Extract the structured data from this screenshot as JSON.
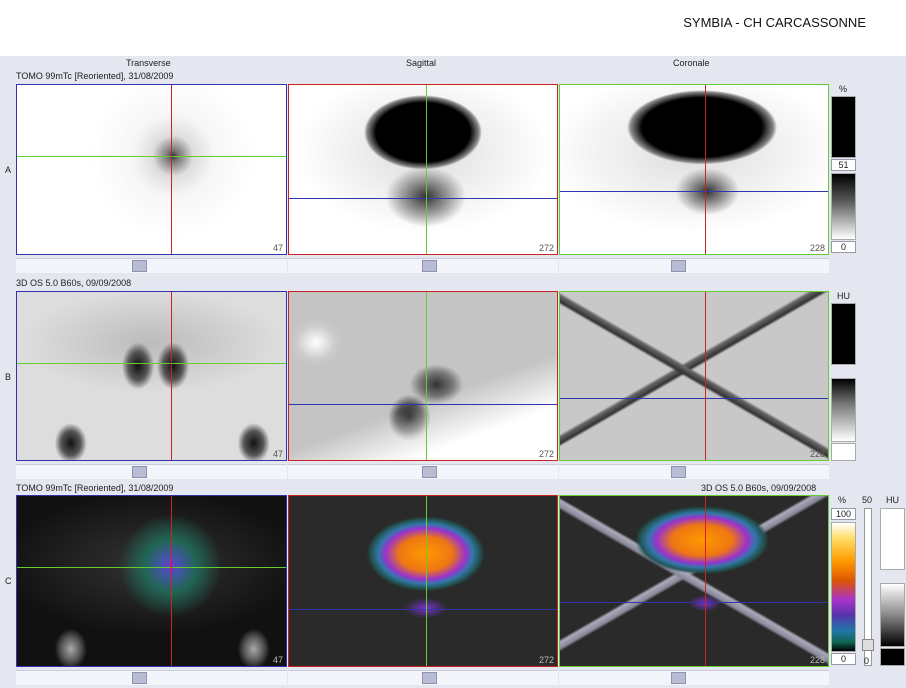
{
  "header": {
    "site_title": "SYMBIA - CH CARCASSONNE"
  },
  "columns": {
    "transverse": "Transverse",
    "sagittal": "Sagittal",
    "coronal": "Coronale"
  },
  "rows": {
    "A": {
      "label": "A",
      "series": "TOMO 99mTc [Reoriented], 31/08/2009",
      "slices": {
        "transverse": "47",
        "sagittal": "272",
        "coronal": "228"
      }
    },
    "B": {
      "label": "B",
      "series": "3D  OS  5.0  B60s, 09/09/2008",
      "slices": {
        "transverse": "47",
        "sagittal": "272",
        "coronal": "228"
      }
    },
    "C": {
      "label": "C",
      "series_left": "TOMO 99mTc [Reoriented], 31/08/2009",
      "series_right": "3D  OS  5.0  B60s, 09/09/2008",
      "slices": {
        "transverse": "47",
        "sagittal": "272",
        "coronal": "228"
      }
    }
  },
  "colorbars": {
    "A": {
      "unit": "%",
      "mid": "51",
      "low": "0"
    },
    "B": {
      "unit": "HU"
    },
    "C": {
      "unit_pct": "%",
      "top": "100",
      "bottom": "0",
      "unit_hu": "HU",
      "blend_top": "50",
      "blend_bottom": "0"
    }
  },
  "crosshair_colors": {
    "transverse": "#3333aa",
    "sagittal": "#cc2222",
    "coronal": "#66cc33"
  }
}
